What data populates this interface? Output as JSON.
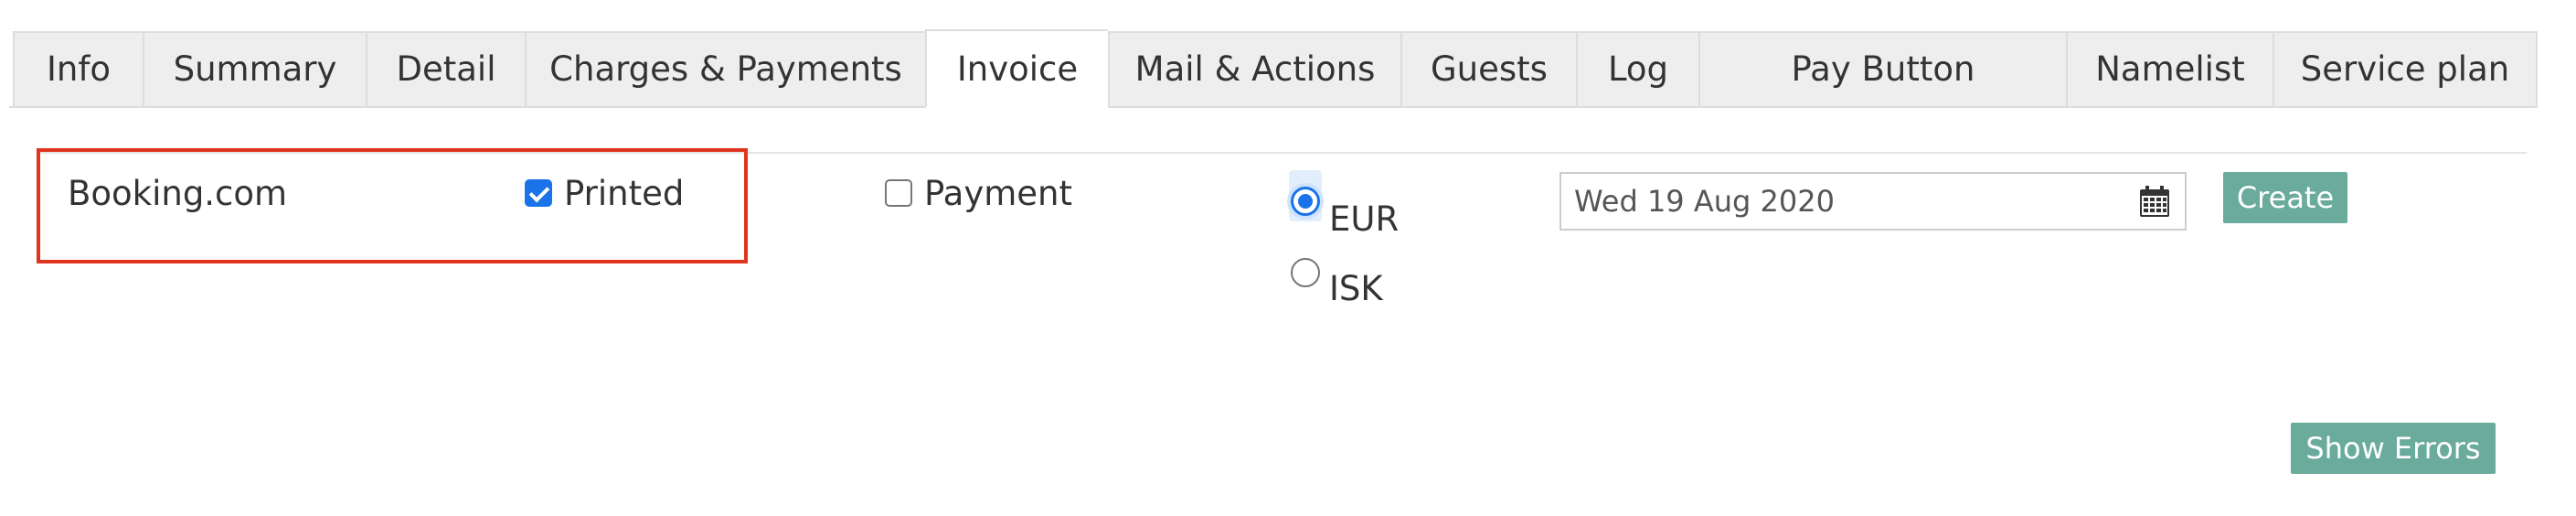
{
  "tabs": [
    {
      "label": "Info",
      "active": false
    },
    {
      "label": "Summary",
      "active": false
    },
    {
      "label": "Detail",
      "active": false
    },
    {
      "label": "Charges & Payments",
      "active": false
    },
    {
      "label": "Invoice",
      "active": true
    },
    {
      "label": "Mail & Actions",
      "active": false
    },
    {
      "label": "Guests",
      "active": false
    },
    {
      "label": "Log",
      "active": false
    },
    {
      "label": "Pay Button",
      "active": false
    },
    {
      "label": "Namelist",
      "active": false
    },
    {
      "label": "Service plan",
      "active": false
    }
  ],
  "invoice": {
    "recipient": "Booking.com",
    "printed": {
      "label": "Printed",
      "checked": true
    },
    "payment": {
      "label": "Payment",
      "checked": false
    },
    "currencies": [
      {
        "label": "EUR",
        "selected": true
      },
      {
        "label": "ISK",
        "selected": false
      }
    ],
    "date_value": "Wed 19 Aug 2020",
    "calendar_icon": "calendar-icon",
    "create_label": "Create",
    "show_errors_label": "Show Errors"
  },
  "colors": {
    "accent_button": "#6aab9c",
    "highlight_border": "#e0341e",
    "checkbox_blue": "#1a73e8"
  }
}
